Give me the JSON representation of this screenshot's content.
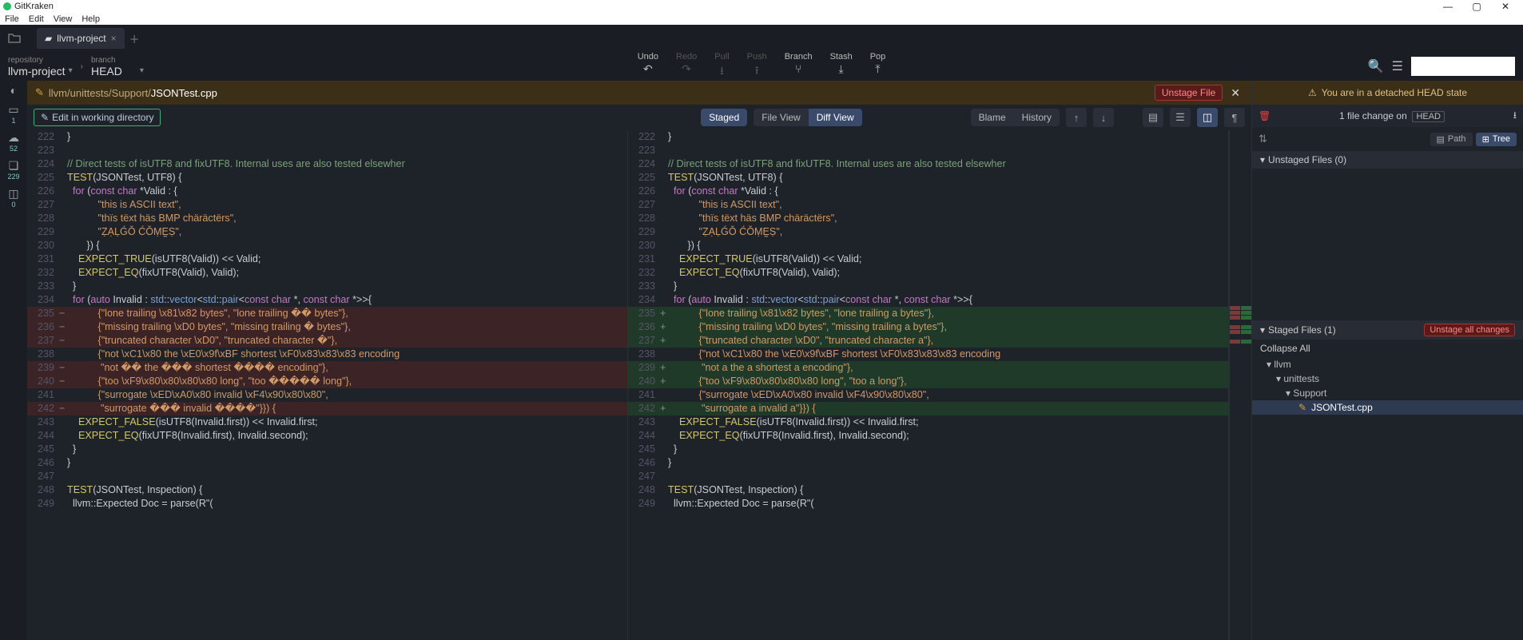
{
  "window": {
    "title": "GitKraken"
  },
  "menubar": [
    "File",
    "Edit",
    "View",
    "Help"
  ],
  "tab": {
    "label": "llvm-project"
  },
  "repo": {
    "label": "repository",
    "name": "llvm-project"
  },
  "branch": {
    "label": "branch",
    "name": "HEAD"
  },
  "toolbar": {
    "undo": "Undo",
    "redo": "Redo",
    "pull": "Pull",
    "push": "Push",
    "branch": "Branch",
    "stash": "Stash",
    "pop": "Pop"
  },
  "left_icons": {
    "play_badge": "1",
    "cloud_badge": "52",
    "tag_badge": "229",
    "layers_badge": "0"
  },
  "file_header": {
    "path_prefix": "llvm/unittests/Support/",
    "filename": "JSONTest.cpp",
    "unstage": "Unstage File"
  },
  "subtoolbar": {
    "edit": "Edit in working directory",
    "staged": "Staged",
    "fileview": "File View",
    "diffview": "Diff View",
    "blame": "Blame",
    "history": "History"
  },
  "right": {
    "warning": "You are in a detached HEAD state",
    "changes_text": "1 file change on",
    "head": "HEAD",
    "path_btn": "Path",
    "tree_btn": "Tree",
    "unstaged_hdr": "Unstaged Files (0)",
    "staged_hdr": "Staged Files (1)",
    "unstage_all": "Unstage all changes",
    "collapse_all": "Collapse All",
    "tree": {
      "l1": "llvm",
      "l2": "unittests",
      "l3": "Support",
      "file": "JSONTest.cpp"
    }
  },
  "code": {
    "l222": "}",
    "l223": "",
    "l224a": "// Direct tests of isUTF8 and fixUTF8. Internal uses are also tested elsewher",
    "l225": "TEST(JSONTest, UTF8) {",
    "l226": "  for (const char *Valid : {",
    "l227": "           \"this is ASCII text\",",
    "l228": "           \"thïs tëxt häs BMP chäräctërs\",",
    "l229": "           \"ẒẠḶǴǑ ĆǑṂḚṢ\",",
    "l230": "       }) {",
    "l231": "    EXPECT_TRUE(isUTF8(Valid)) << Valid;",
    "l232": "    EXPECT_EQ(fixUTF8(Valid), Valid);",
    "l233": "  }",
    "l234": "  for (auto Invalid : std::vector<std::pair<const char *, const char *>>{",
    "l235L": "           {\"lone trailing \\x81\\x82 bytes\", \"lone trailing �� bytes\"},",
    "l235R": "           {\"lone trailing \\x81\\x82 bytes\", \"lone trailing a bytes\"},",
    "l236L": "           {\"missing trailing \\xD0 bytes\", \"missing trailing � bytes\"},",
    "l236R": "           {\"missing trailing \\xD0 bytes\", \"missing trailing a bytes\"},",
    "l237L": "           {\"truncated character \\xD0\", \"truncated character �\"},",
    "l237R": "           {\"truncated character \\xD0\", \"truncated character a\"},",
    "l238": "           {\"not \\xC1\\x80 the \\xE0\\x9f\\xBF shortest \\xF0\\x83\\x83\\x83 encoding",
    "l239L": "            \"not �� the ��� shortest ���� encoding\"},",
    "l239R": "            \"not a the a shortest a encoding\"},",
    "l240L": "           {\"too \\xF9\\x80\\x80\\x80\\x80 long\", \"too ����� long\"},",
    "l240R": "           {\"too \\xF9\\x80\\x80\\x80\\x80 long\", \"too a long\"},",
    "l241": "           {\"surrogate \\xED\\xA0\\x80 invalid \\xF4\\x90\\x80\\x80\",",
    "l242L": "            \"surrogate ��� invalid ����\"}}) {",
    "l242R": "            \"surrogate a invalid a\"}}) {",
    "l243": "    EXPECT_FALSE(isUTF8(Invalid.first)) << Invalid.first;",
    "l244": "    EXPECT_EQ(fixUTF8(Invalid.first), Invalid.second);",
    "l245": "  }",
    "l246": "}",
    "l247": "",
    "l248": "TEST(JSONTest, Inspection) {",
    "l249": "  llvm::Expected<Value> Doc = parse(R\"("
  }
}
